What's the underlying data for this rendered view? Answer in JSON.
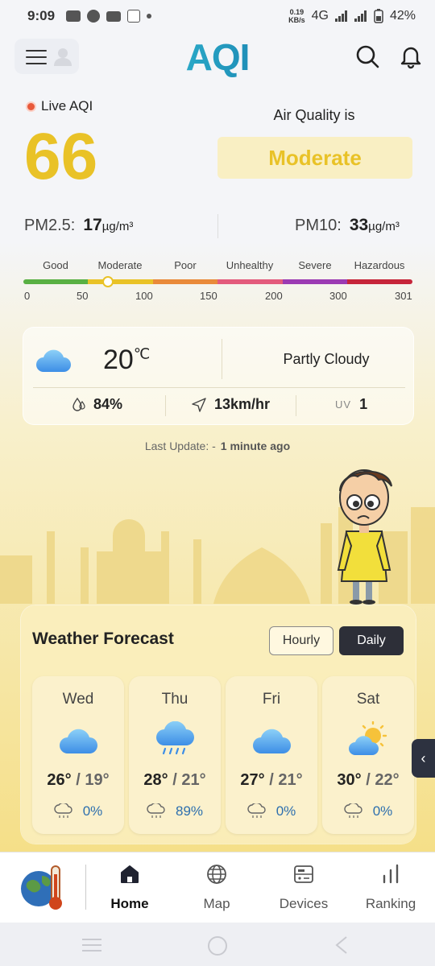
{
  "status_bar": {
    "time": "9:09",
    "net_speed": "0.19\nKB/s",
    "network": "4G",
    "battery": "42%"
  },
  "header": {
    "logo": "AQI"
  },
  "aqi": {
    "live_label": "Live AQI",
    "value": "66",
    "quality_label": "Air Quality is",
    "quality_status": "Moderate",
    "status_color": "#e9c227"
  },
  "pollutants": {
    "pm25": {
      "label": "PM2.5:",
      "value": "17",
      "unit": "µg/m³"
    },
    "pm10": {
      "label": "PM10:",
      "value": "33",
      "unit": "µg/m³"
    }
  },
  "scale": {
    "categories": [
      {
        "label": "Good",
        "color": "#59b043"
      },
      {
        "label": "Moderate",
        "color": "#e9c227"
      },
      {
        "label": "Poor",
        "color": "#e98a3a"
      },
      {
        "label": "Unhealthy",
        "color": "#e35b7c"
      },
      {
        "label": "Severe",
        "color": "#9b3ab3"
      },
      {
        "label": "Hazardous",
        "color": "#c6253a"
      }
    ],
    "ticks": [
      "0",
      "50",
      "100",
      "150",
      "200",
      "300",
      "301"
    ]
  },
  "weather": {
    "icon": "cloud-icon",
    "temperature": "20",
    "temp_unit": "℃",
    "description": "Partly Cloudy",
    "humidity": "84%",
    "wind": "13km/hr",
    "uv_label": "UV",
    "uv": "1"
  },
  "last_update": {
    "label": "Last Update: -",
    "value": "1 minute ago"
  },
  "forecast": {
    "title": "Weather Forecast",
    "toggle": {
      "hourly": "Hourly",
      "daily": "Daily",
      "selected": "Daily"
    },
    "days": [
      {
        "name": "Wed",
        "icon": "cloud-icon",
        "high": "26°",
        "sep": " / ",
        "low": "19°",
        "precip": "0%"
      },
      {
        "name": "Thu",
        "icon": "rain-cloud-icon",
        "high": "28°",
        "sep": " / ",
        "low": "21°",
        "precip": "89%"
      },
      {
        "name": "Fri",
        "icon": "cloud-icon",
        "high": "27°",
        "sep": " / ",
        "low": "21°",
        "precip": "0%"
      },
      {
        "name": "Sat",
        "icon": "sun-cloud-icon",
        "high": "30°",
        "sep": " / ",
        "low": "22°",
        "precip": "0%"
      }
    ]
  },
  "bottom_nav": {
    "items": [
      {
        "label": "Home",
        "icon": "home-icon",
        "active": true
      },
      {
        "label": "Map",
        "icon": "globe-icon",
        "active": false
      },
      {
        "label": "Devices",
        "icon": "device-icon",
        "active": false
      },
      {
        "label": "Ranking",
        "icon": "ranking-icon",
        "active": false
      }
    ]
  }
}
